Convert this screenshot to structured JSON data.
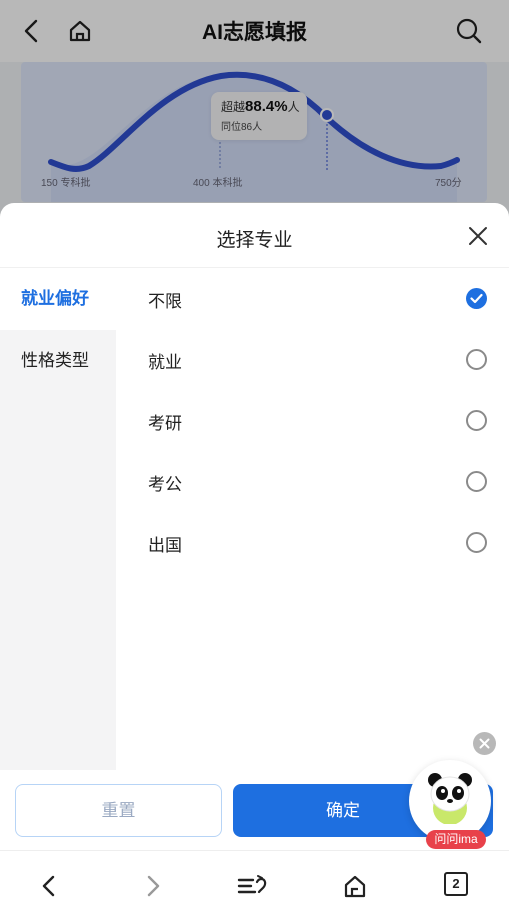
{
  "app": {
    "title": "AI志愿填报"
  },
  "chart_data": {
    "type": "area",
    "tooltip": {
      "prefix": "超越",
      "value": "88.4%",
      "suffix": "人",
      "same_rank": "同位86人"
    },
    "ticks": [
      "150 专科批",
      "400 本科批",
      "750分"
    ]
  },
  "sheet": {
    "title": "选择专业",
    "nav": [
      {
        "label": "就业偏好",
        "active": true
      },
      {
        "label": "性格类型",
        "active": false
      }
    ],
    "options": [
      {
        "label": "不限",
        "checked": true
      },
      {
        "label": "就业",
        "checked": false
      },
      {
        "label": "考研",
        "checked": false
      },
      {
        "label": "考公",
        "checked": false
      },
      {
        "label": "出国",
        "checked": false
      }
    ],
    "reset_label": "重置",
    "confirm_label": "确定"
  },
  "ima": {
    "badge": "问问ima"
  },
  "browser": {
    "tab_count": "2"
  },
  "colors": {
    "accent": "#1e6fe0",
    "chart_line": "#2f4fd0",
    "badge": "#e8414a"
  }
}
